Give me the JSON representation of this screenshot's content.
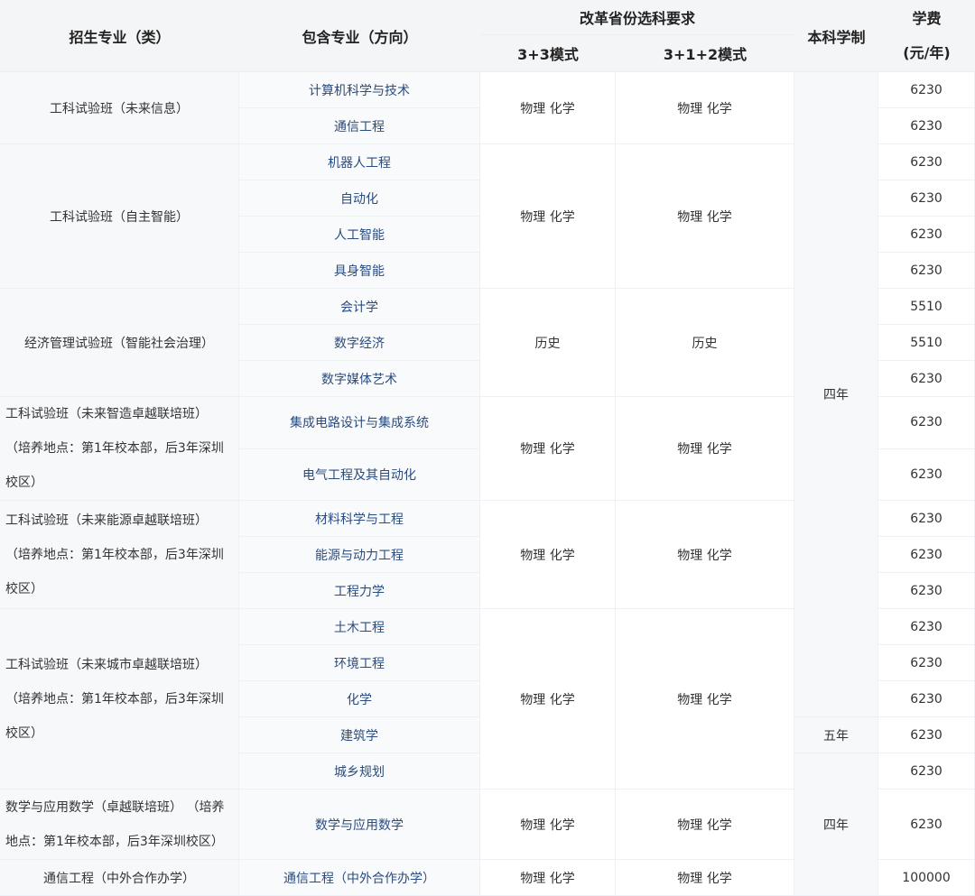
{
  "header": {
    "category": "招生专业（类）",
    "includes": "包含专业（方向）",
    "requirement_group": "改革省份选科要求",
    "mode_33": "3+3模式",
    "mode_312": "3+1+2模式",
    "duration": "本科学制",
    "fee_line1": "学费",
    "fee_line2": "(元/年)"
  },
  "groups": [
    {
      "category": "工科试验班（未来信息）",
      "req_33": "物理 化学",
      "req_312": "物理 化学",
      "majors": [
        {
          "name": "计算机科学与技术",
          "fee": "6230"
        },
        {
          "name": "通信工程",
          "fee": "6230"
        }
      ]
    },
    {
      "category": "工科试验班（自主智能）",
      "req_33": "物理 化学",
      "req_312": "物理 化学",
      "majors": [
        {
          "name": "机器人工程",
          "fee": "6230"
        },
        {
          "name": "自动化",
          "fee": "6230"
        },
        {
          "name": "人工智能",
          "fee": "6230"
        },
        {
          "name": "具身智能",
          "fee": "6230"
        }
      ]
    },
    {
      "category": "经济管理试验班（智能社会治理）",
      "req_33": "历史",
      "req_312": "历史",
      "majors": [
        {
          "name": "会计学",
          "fee": "5510"
        },
        {
          "name": "数字经济",
          "fee": "5510"
        },
        {
          "name": "数字媒体艺术",
          "fee": "6230"
        }
      ]
    },
    {
      "category": "工科试验班（未来智造卓越联培班） （培养地点：第1年校本部，后3年深圳校区）",
      "req_33": "物理 化学",
      "req_312": "物理 化学",
      "majors": [
        {
          "name": "集成电路设计与集成系统",
          "fee": "6230"
        },
        {
          "name": "电气工程及其自动化",
          "fee": "6230"
        }
      ]
    },
    {
      "category": "工科试验班（未来能源卓越联培班） （培养地点：第1年校本部，后3年深圳校区）",
      "req_33": "物理 化学",
      "req_312": "物理 化学",
      "majors": [
        {
          "name": "材料科学与工程",
          "fee": "6230"
        },
        {
          "name": "能源与动力工程",
          "fee": "6230"
        },
        {
          "name": "工程力学",
          "fee": "6230"
        }
      ]
    },
    {
      "category": "工科试验班（未来城市卓越联培班） （培养地点：第1年校本部，后3年深圳校区）",
      "req_33": "物理 化学",
      "req_312": "物理 化学",
      "majors": [
        {
          "name": "土木工程",
          "fee": "6230"
        },
        {
          "name": "环境工程",
          "fee": "6230"
        },
        {
          "name": "化学",
          "fee": "6230"
        },
        {
          "name": "建筑学",
          "fee": "6230"
        },
        {
          "name": "城乡规划",
          "fee": "6230"
        }
      ]
    },
    {
      "category": "数学与应用数学（卓越联培班） （培养地点：第1年校本部，后3年深圳校区）",
      "req_33": "物理 化学",
      "req_312": "物理 化学",
      "majors": [
        {
          "name": "数学与应用数学",
          "fee": "6230"
        }
      ]
    },
    {
      "category": "通信工程（中外合作办学）",
      "req_33": "物理 化学",
      "req_312": "物理 化学",
      "majors": [
        {
          "name": "通信工程（中外合作办学）",
          "fee": "100000"
        }
      ]
    }
  ],
  "durations": {
    "four_year_a": "四年",
    "five_year": "五年",
    "four_year_b": "四年"
  }
}
